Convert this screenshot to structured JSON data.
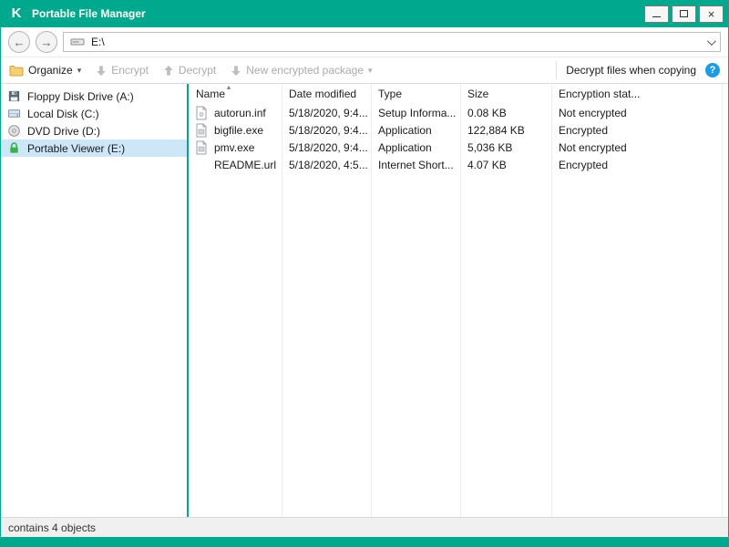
{
  "window": {
    "title": "Portable File Manager"
  },
  "icons": {
    "logo": "K",
    "close": "×",
    "back": "←",
    "forward": "→",
    "caret": "▾",
    "sort_asc": "▴",
    "help": "?"
  },
  "navbar": {
    "address": "E:\\"
  },
  "toolbar": {
    "organize": "Organize",
    "encrypt": "Encrypt",
    "decrypt": "Decrypt",
    "new_package": "New encrypted package",
    "decrypt_when_copying": "Decrypt files when copying"
  },
  "sidebar": {
    "items": [
      {
        "label": "Floppy Disk Drive (A:)"
      },
      {
        "label": "Local Disk (C:)"
      },
      {
        "label": "DVD Drive (D:)"
      },
      {
        "label": "Portable Viewer (E:)"
      }
    ]
  },
  "list": {
    "columns": {
      "name": "Name",
      "date": "Date modified",
      "type": "Type",
      "size": "Size",
      "encryption": "Encryption stat..."
    },
    "rows": [
      {
        "name": "autorun.inf",
        "date": "5/18/2020, 9:4...",
        "type": "Setup Informa...",
        "size": "0.08 KB",
        "encryption": "Not encrypted"
      },
      {
        "name": "bigfile.exe",
        "date": "5/18/2020, 9:4...",
        "type": "Application",
        "size": "122,884 KB",
        "encryption": "Encrypted"
      },
      {
        "name": "pmv.exe",
        "date": "5/18/2020, 9:4...",
        "type": "Application",
        "size": "5,036 KB",
        "encryption": "Not encrypted"
      },
      {
        "name": "README.url",
        "date": "5/18/2020, 4:5...",
        "type": "Internet Short...",
        "size": "4.07 KB",
        "encryption": "Encrypted"
      }
    ]
  },
  "statusbar": {
    "text": "contains 4 objects"
  },
  "colors": {
    "accent": "#00a88e",
    "selected_bg": "#cde7f8",
    "help_blue": "#1f9be6",
    "disabled_text": "#ababab"
  }
}
